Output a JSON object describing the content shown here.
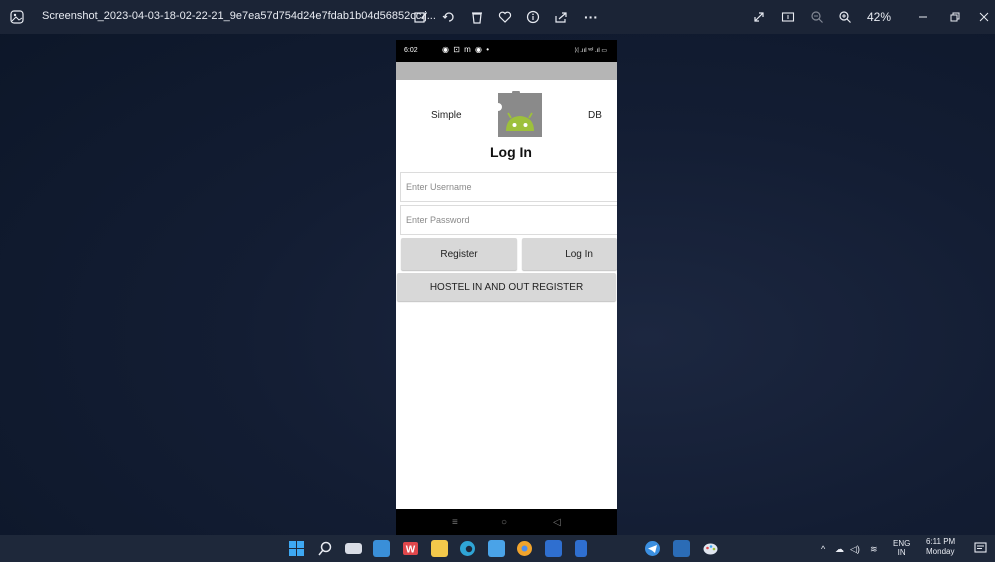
{
  "window": {
    "filename": "Screenshot_2023-04-03-18-02-22-21_9e7ea57d754d24e7fdab1b04d56852cc.j...",
    "zoom": "42%",
    "more": "···"
  },
  "phone": {
    "status": {
      "time": "6:02",
      "icons": "◉ ⊡ m ◉ •",
      "right": "ᛞ .ııl ᵛᵒˡ .ıl ▭"
    },
    "app": {
      "left_label": "Simple",
      "right_label": "DB",
      "title": "Log In",
      "username_placeholder": "Enter Username",
      "password_placeholder": "Enter Password",
      "register_label": "Register",
      "login_label": "Log In",
      "hostel_label": "HOSTEL IN AND OUT REGISTER"
    },
    "nav": {
      "menu": "≡",
      "home": "○",
      "back": "◁"
    }
  },
  "taskbar": {
    "tray_lang": "ENG",
    "tray_region": "IN",
    "time": "6:11 PM",
    "day": "Monday"
  },
  "colors": {
    "android_green": "#9dc03b",
    "logo_gray": "#8a8a8a",
    "taskbar": "#1e283a",
    "desktop": "#0f1a2e"
  }
}
